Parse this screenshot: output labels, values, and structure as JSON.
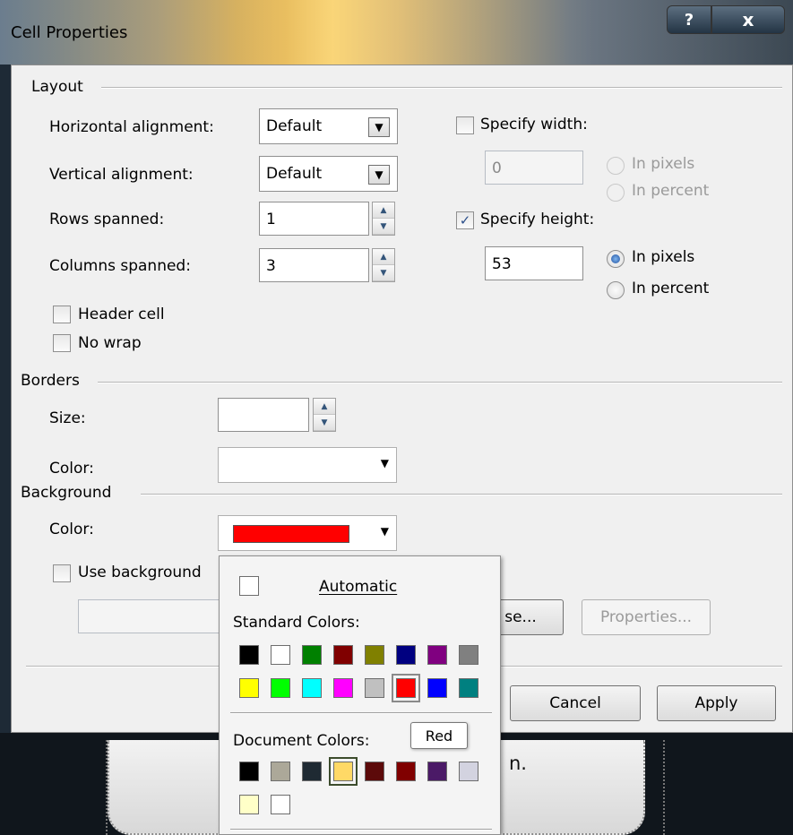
{
  "window": {
    "title": "Cell Properties",
    "help_label": "?",
    "close_label": "x"
  },
  "layout": {
    "section_label": "Layout",
    "horizontal_alignment": {
      "label": "Horizontal alignment:",
      "value": "Default"
    },
    "vertical_alignment": {
      "label": "Vertical alignment:",
      "value": "Default"
    },
    "rows_spanned": {
      "label": "Rows spanned:",
      "value": "1"
    },
    "columns_spanned": {
      "label": "Columns spanned:",
      "value": "3"
    },
    "header_cell": {
      "label": "Header cell",
      "checked": false
    },
    "no_wrap": {
      "label": "No wrap",
      "checked": false
    },
    "specify_width": {
      "label": "Specify width:",
      "checked": false,
      "value": "0",
      "in_pixels": "In pixels",
      "in_percent": "In percent"
    },
    "specify_height": {
      "label": "Specify height:",
      "checked": true,
      "value": "53",
      "in_pixels": "In pixels",
      "in_percent": "In percent"
    }
  },
  "borders": {
    "section_label": "Borders",
    "size_label": "Size:",
    "size_value": "",
    "color_label": "Color:"
  },
  "background": {
    "section_label": "Background",
    "color_label": "Color:",
    "color_value": "#ff0000",
    "use_background_label": "Use background",
    "browse_label": "se...",
    "properties_label": "Properties..."
  },
  "buttons": {
    "cancel": "Cancel",
    "apply": "Apply"
  },
  "palette": {
    "automatic": "Automatic",
    "standard_heading": "Standard Colors:",
    "standard_colors": [
      "#000000",
      "#ffffff",
      "#008000",
      "#800000",
      "#808000",
      "#000080",
      "#800080",
      "#808080",
      "#ffff00",
      "#00ff00",
      "#00ffff",
      "#ff00ff",
      "#c0c0c0",
      "#ff0000",
      "#0000ff",
      "#008080"
    ],
    "selected_standard": "#ff0000",
    "document_heading": "Document Colors:",
    "document_colors": [
      "#000000",
      "#aca899",
      "#1f2a33",
      "#ffd966",
      "#5c0a0a",
      "#800000",
      "#4b1a67",
      "#d3d3e0",
      "#ffffc8",
      "#ffffff"
    ],
    "hovered_document": "#ffd966",
    "tooltip": "Red"
  },
  "background_fragment": "n."
}
